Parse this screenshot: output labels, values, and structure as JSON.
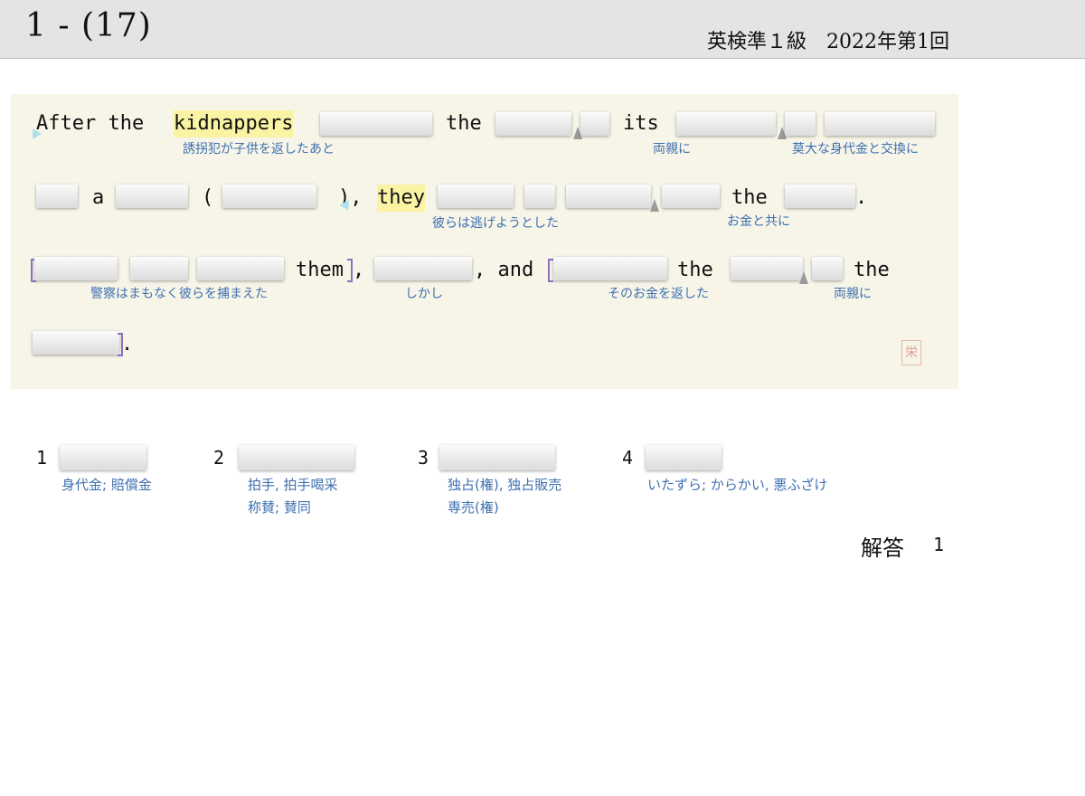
{
  "header": {
    "question_number": "1 - (17)",
    "exam_title": "英検準１級　2022年第1回"
  },
  "sentence": {
    "line1": {
      "w_after": "After the ",
      "w_kidnappers": "kidnappers",
      "w_the": "the",
      "w_its": "its"
    },
    "line2": {
      "w_a": "a",
      "w_paren_open": "(",
      "w_paren_close": "),",
      "w_they": "they",
      "w_the": "the",
      "w_period": "."
    },
    "line3": {
      "w_them": "them",
      "w_comma": ",",
      "w_and": ", and",
      "w_the1": "the",
      "w_the2": "the"
    },
    "line4": {
      "w_period": "."
    }
  },
  "glosses": {
    "g1": "誘拐犯が子供を返したあと",
    "g2": "両親に",
    "g3": "莫大な身代金と交換に",
    "g4": "彼らは逃げようとした",
    "g5": "お金と共に",
    "g6": "警察はまもなく彼らを捕まえた",
    "g7": "しかし",
    "g8": "そのお金を返した",
    "g9": "両親に"
  },
  "seal_char": "栄",
  "options": [
    {
      "number": "1",
      "gloss_lines": [
        "身代金; 賠償金"
      ]
    },
    {
      "number": "2",
      "gloss_lines": [
        "拍手, 拍手喝采",
        "称賛; 賛同"
      ]
    },
    {
      "number": "3",
      "gloss_lines": [
        "独占(権), 独占販売",
        "専売(権)"
      ]
    },
    {
      "number": "4",
      "gloss_lines": [
        "いたずら; からかい, 悪ふざけ"
      ]
    }
  ],
  "answer": {
    "label": "解答",
    "value": "1"
  }
}
